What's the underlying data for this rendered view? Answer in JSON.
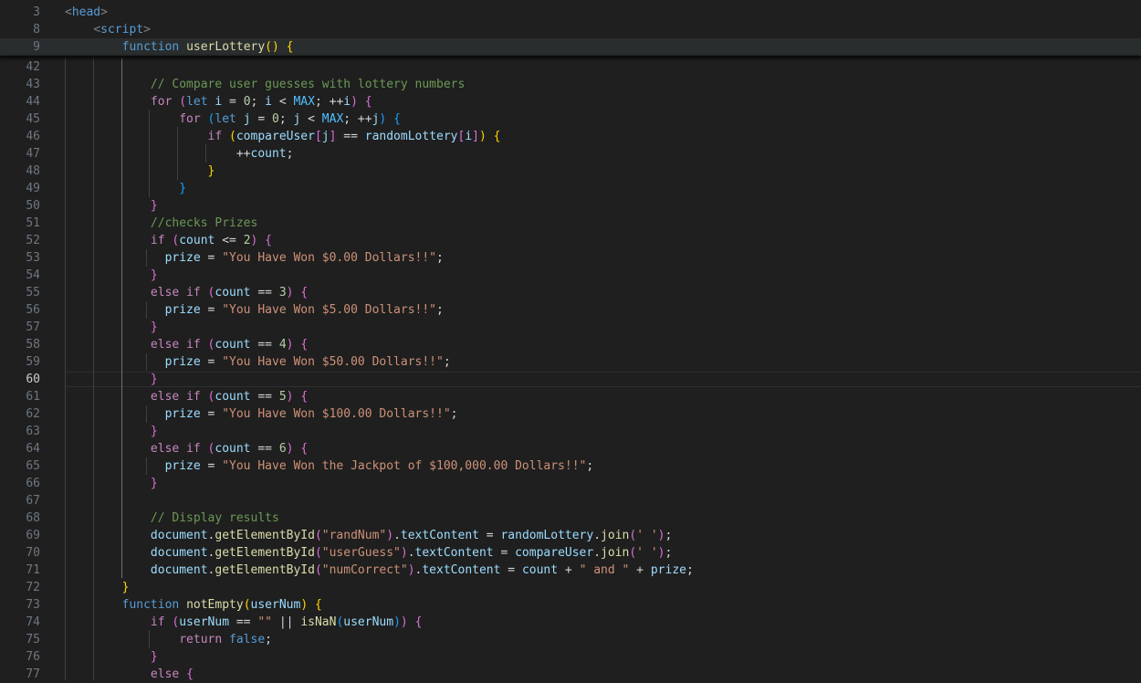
{
  "editor": {
    "sticky_lines": [
      {
        "n": "3",
        "tokens": [
          [
            "tb",
            "<"
          ],
          [
            "t",
            "head"
          ],
          [
            "tb",
            ">"
          ]
        ]
      },
      {
        "n": "8",
        "tokens": [
          [
            "p",
            "    "
          ],
          [
            "tb",
            "<"
          ],
          [
            "t",
            "script"
          ],
          [
            "tb",
            ">"
          ]
        ]
      },
      {
        "n": "9",
        "tokens": [
          [
            "p",
            "        "
          ],
          [
            "k",
            "function"
          ],
          [
            "p",
            " "
          ],
          [
            "f",
            "userLottery"
          ],
          [
            "b1",
            "()"
          ],
          [
            "p",
            " "
          ],
          [
            "b1",
            "{"
          ]
        ]
      }
    ],
    "lines": [
      {
        "n": "42",
        "tokens": []
      },
      {
        "n": "43",
        "tokens": [
          [
            "p",
            "            "
          ],
          [
            "cm",
            "// Compare user guesses with lottery numbers"
          ]
        ]
      },
      {
        "n": "44",
        "tokens": [
          [
            "p",
            "            "
          ],
          [
            "c",
            "for"
          ],
          [
            "p",
            " "
          ],
          [
            "b2",
            "("
          ],
          [
            "k",
            "let"
          ],
          [
            "p",
            " "
          ],
          [
            "v",
            "i"
          ],
          [
            "p",
            " = "
          ],
          [
            "n",
            "0"
          ],
          [
            "p",
            "; "
          ],
          [
            "v",
            "i"
          ],
          [
            "p",
            " < "
          ],
          [
            "cn",
            "MAX"
          ],
          [
            "p",
            "; ++"
          ],
          [
            "v",
            "i"
          ],
          [
            "b2",
            ")"
          ],
          [
            "p",
            " "
          ],
          [
            "b2",
            "{"
          ]
        ]
      },
      {
        "n": "45",
        "tokens": [
          [
            "p",
            "                "
          ],
          [
            "c",
            "for"
          ],
          [
            "p",
            " "
          ],
          [
            "b3",
            "("
          ],
          [
            "k",
            "let"
          ],
          [
            "p",
            " "
          ],
          [
            "v",
            "j"
          ],
          [
            "p",
            " = "
          ],
          [
            "n",
            "0"
          ],
          [
            "p",
            "; "
          ],
          [
            "v",
            "j"
          ],
          [
            "p",
            " < "
          ],
          [
            "cn",
            "MAX"
          ],
          [
            "p",
            "; ++"
          ],
          [
            "v",
            "j"
          ],
          [
            "b3",
            ")"
          ],
          [
            "p",
            " "
          ],
          [
            "b3",
            "{"
          ]
        ]
      },
      {
        "n": "46",
        "tokens": [
          [
            "p",
            "                    "
          ],
          [
            "c",
            "if"
          ],
          [
            "p",
            " "
          ],
          [
            "b1",
            "("
          ],
          [
            "v",
            "compareUser"
          ],
          [
            "b2",
            "["
          ],
          [
            "v",
            "j"
          ],
          [
            "b2",
            "]"
          ],
          [
            "p",
            " == "
          ],
          [
            "v",
            "randomLottery"
          ],
          [
            "b2",
            "["
          ],
          [
            "v",
            "i"
          ],
          [
            "b2",
            "]"
          ],
          [
            "b1",
            ")"
          ],
          [
            "p",
            " "
          ],
          [
            "b1",
            "{"
          ]
        ]
      },
      {
        "n": "47",
        "tokens": [
          [
            "p",
            "                        ++"
          ],
          [
            "v",
            "count"
          ],
          [
            "p",
            ";"
          ]
        ]
      },
      {
        "n": "48",
        "tokens": [
          [
            "p",
            "                    "
          ],
          [
            "b1",
            "}"
          ]
        ]
      },
      {
        "n": "49",
        "tokens": [
          [
            "p",
            "                "
          ],
          [
            "b3",
            "}"
          ]
        ]
      },
      {
        "n": "50",
        "tokens": [
          [
            "p",
            "            "
          ],
          [
            "b2",
            "}"
          ]
        ]
      },
      {
        "n": "51",
        "tokens": [
          [
            "p",
            "            "
          ],
          [
            "cm",
            "//checks Prizes"
          ]
        ]
      },
      {
        "n": "52",
        "tokens": [
          [
            "p",
            "            "
          ],
          [
            "c",
            "if"
          ],
          [
            "p",
            " "
          ],
          [
            "b2",
            "("
          ],
          [
            "v",
            "count"
          ],
          [
            "p",
            " <= "
          ],
          [
            "n",
            "2"
          ],
          [
            "b2",
            ")"
          ],
          [
            "p",
            " "
          ],
          [
            "b2",
            "{"
          ]
        ]
      },
      {
        "n": "53",
        "tokens": [
          [
            "p",
            "              "
          ],
          [
            "v",
            "prize"
          ],
          [
            "p",
            " = "
          ],
          [
            "s",
            "\"You Have Won $0.00 Dollars!!\""
          ],
          [
            "p",
            ";"
          ]
        ]
      },
      {
        "n": "54",
        "tokens": [
          [
            "p",
            "            "
          ],
          [
            "b2",
            "}"
          ]
        ]
      },
      {
        "n": "55",
        "tokens": [
          [
            "p",
            "            "
          ],
          [
            "c",
            "else"
          ],
          [
            "p",
            " "
          ],
          [
            "c",
            "if"
          ],
          [
            "p",
            " "
          ],
          [
            "b2",
            "("
          ],
          [
            "v",
            "count"
          ],
          [
            "p",
            " == "
          ],
          [
            "n",
            "3"
          ],
          [
            "b2",
            ")"
          ],
          [
            "p",
            " "
          ],
          [
            "b2",
            "{"
          ]
        ]
      },
      {
        "n": "56",
        "tokens": [
          [
            "p",
            "              "
          ],
          [
            "v",
            "prize"
          ],
          [
            "p",
            " = "
          ],
          [
            "s",
            "\"You Have Won $5.00 Dollars!!\""
          ],
          [
            "p",
            ";"
          ]
        ]
      },
      {
        "n": "57",
        "tokens": [
          [
            "p",
            "            "
          ],
          [
            "b2",
            "}"
          ]
        ]
      },
      {
        "n": "58",
        "tokens": [
          [
            "p",
            "            "
          ],
          [
            "c",
            "else"
          ],
          [
            "p",
            " "
          ],
          [
            "c",
            "if"
          ],
          [
            "p",
            " "
          ],
          [
            "b2",
            "("
          ],
          [
            "v",
            "count"
          ],
          [
            "p",
            " == "
          ],
          [
            "n",
            "4"
          ],
          [
            "b2",
            ")"
          ],
          [
            "p",
            " "
          ],
          [
            "b2",
            "{"
          ]
        ]
      },
      {
        "n": "59",
        "tokens": [
          [
            "p",
            "              "
          ],
          [
            "v",
            "prize"
          ],
          [
            "p",
            " = "
          ],
          [
            "s",
            "\"You Have Won $50.00 Dollars!!\""
          ],
          [
            "p",
            ";"
          ]
        ]
      },
      {
        "n": "60",
        "tokens": [
          [
            "p",
            "            "
          ],
          [
            "b2",
            "}"
          ]
        ],
        "active": true
      },
      {
        "n": "61",
        "tokens": [
          [
            "p",
            "            "
          ],
          [
            "c",
            "else"
          ],
          [
            "p",
            " "
          ],
          [
            "c",
            "if"
          ],
          [
            "p",
            " "
          ],
          [
            "b2",
            "("
          ],
          [
            "v",
            "count"
          ],
          [
            "p",
            " == "
          ],
          [
            "n",
            "5"
          ],
          [
            "b2",
            ")"
          ],
          [
            "p",
            " "
          ],
          [
            "b2",
            "{"
          ]
        ]
      },
      {
        "n": "62",
        "tokens": [
          [
            "p",
            "              "
          ],
          [
            "v",
            "prize"
          ],
          [
            "p",
            " = "
          ],
          [
            "s",
            "\"You Have Won $100.00 Dollars!!\""
          ],
          [
            "p",
            ";"
          ]
        ]
      },
      {
        "n": "63",
        "tokens": [
          [
            "p",
            "            "
          ],
          [
            "b2",
            "}"
          ]
        ]
      },
      {
        "n": "64",
        "tokens": [
          [
            "p",
            "            "
          ],
          [
            "c",
            "else"
          ],
          [
            "p",
            " "
          ],
          [
            "c",
            "if"
          ],
          [
            "p",
            " "
          ],
          [
            "b2",
            "("
          ],
          [
            "v",
            "count"
          ],
          [
            "p",
            " == "
          ],
          [
            "n",
            "6"
          ],
          [
            "b2",
            ")"
          ],
          [
            "p",
            " "
          ],
          [
            "b2",
            "{"
          ]
        ]
      },
      {
        "n": "65",
        "tokens": [
          [
            "p",
            "              "
          ],
          [
            "v",
            "prize"
          ],
          [
            "p",
            " = "
          ],
          [
            "s",
            "\"You Have Won the Jackpot of $100,000.00 Dollars!!\""
          ],
          [
            "p",
            ";"
          ]
        ]
      },
      {
        "n": "66",
        "tokens": [
          [
            "p",
            "            "
          ],
          [
            "b2",
            "}"
          ]
        ]
      },
      {
        "n": "67",
        "tokens": []
      },
      {
        "n": "68",
        "tokens": [
          [
            "p",
            "            "
          ],
          [
            "cm",
            "// Display results"
          ]
        ]
      },
      {
        "n": "69",
        "tokens": [
          [
            "p",
            "            "
          ],
          [
            "v",
            "document"
          ],
          [
            "p",
            "."
          ],
          [
            "f",
            "getElementById"
          ],
          [
            "b2",
            "("
          ],
          [
            "s",
            "\"randNum\""
          ],
          [
            "b2",
            ")"
          ],
          [
            "p",
            "."
          ],
          [
            "v",
            "textContent"
          ],
          [
            "p",
            " = "
          ],
          [
            "v",
            "randomLottery"
          ],
          [
            "p",
            "."
          ],
          [
            "f",
            "join"
          ],
          [
            "b2",
            "("
          ],
          [
            "s",
            "' '"
          ],
          [
            "b2",
            ")"
          ],
          [
            "p",
            ";"
          ]
        ]
      },
      {
        "n": "70",
        "tokens": [
          [
            "p",
            "            "
          ],
          [
            "v",
            "document"
          ],
          [
            "p",
            "."
          ],
          [
            "f",
            "getElementById"
          ],
          [
            "b2",
            "("
          ],
          [
            "s",
            "\"userGuess\""
          ],
          [
            "b2",
            ")"
          ],
          [
            "p",
            "."
          ],
          [
            "v",
            "textContent"
          ],
          [
            "p",
            " = "
          ],
          [
            "v",
            "compareUser"
          ],
          [
            "p",
            "."
          ],
          [
            "f",
            "join"
          ],
          [
            "b2",
            "("
          ],
          [
            "s",
            "' '"
          ],
          [
            "b2",
            ")"
          ],
          [
            "p",
            ";"
          ]
        ]
      },
      {
        "n": "71",
        "tokens": [
          [
            "p",
            "            "
          ],
          [
            "v",
            "document"
          ],
          [
            "p",
            "."
          ],
          [
            "f",
            "getElementById"
          ],
          [
            "b2",
            "("
          ],
          [
            "s",
            "\"numCorrect\""
          ],
          [
            "b2",
            ")"
          ],
          [
            "p",
            "."
          ],
          [
            "v",
            "textContent"
          ],
          [
            "p",
            " = "
          ],
          [
            "v",
            "count"
          ],
          [
            "p",
            " + "
          ],
          [
            "s",
            "\" and \""
          ],
          [
            "p",
            " + "
          ],
          [
            "v",
            "prize"
          ],
          [
            "p",
            ";"
          ]
        ]
      },
      {
        "n": "72",
        "tokens": [
          [
            "p",
            "        "
          ],
          [
            "b1",
            "}"
          ]
        ]
      },
      {
        "n": "73",
        "tokens": [
          [
            "p",
            "        "
          ],
          [
            "k",
            "function"
          ],
          [
            "p",
            " "
          ],
          [
            "f",
            "notEmpty"
          ],
          [
            "b1",
            "("
          ],
          [
            "v",
            "userNum"
          ],
          [
            "b1",
            ")"
          ],
          [
            "p",
            " "
          ],
          [
            "b1",
            "{"
          ]
        ]
      },
      {
        "n": "74",
        "tokens": [
          [
            "p",
            "            "
          ],
          [
            "c",
            "if"
          ],
          [
            "p",
            " "
          ],
          [
            "b2",
            "("
          ],
          [
            "v",
            "userNum"
          ],
          [
            "p",
            " == "
          ],
          [
            "s",
            "\"\""
          ],
          [
            "p",
            " || "
          ],
          [
            "f",
            "isNaN"
          ],
          [
            "b3",
            "("
          ],
          [
            "v",
            "userNum"
          ],
          [
            "b3",
            ")"
          ],
          [
            "b2",
            ")"
          ],
          [
            "p",
            " "
          ],
          [
            "b2",
            "{"
          ]
        ]
      },
      {
        "n": "75",
        "tokens": [
          [
            "p",
            "                "
          ],
          [
            "c",
            "return"
          ],
          [
            "p",
            " "
          ],
          [
            "k",
            "false"
          ],
          [
            "p",
            ";"
          ]
        ]
      },
      {
        "n": "76",
        "tokens": [
          [
            "p",
            "            "
          ],
          [
            "b2",
            "}"
          ]
        ]
      },
      {
        "n": "77",
        "tokens": [
          [
            "p",
            "            "
          ],
          [
            "c",
            "else"
          ],
          [
            "p",
            " "
          ],
          [
            "b2",
            "{"
          ]
        ]
      }
    ]
  }
}
